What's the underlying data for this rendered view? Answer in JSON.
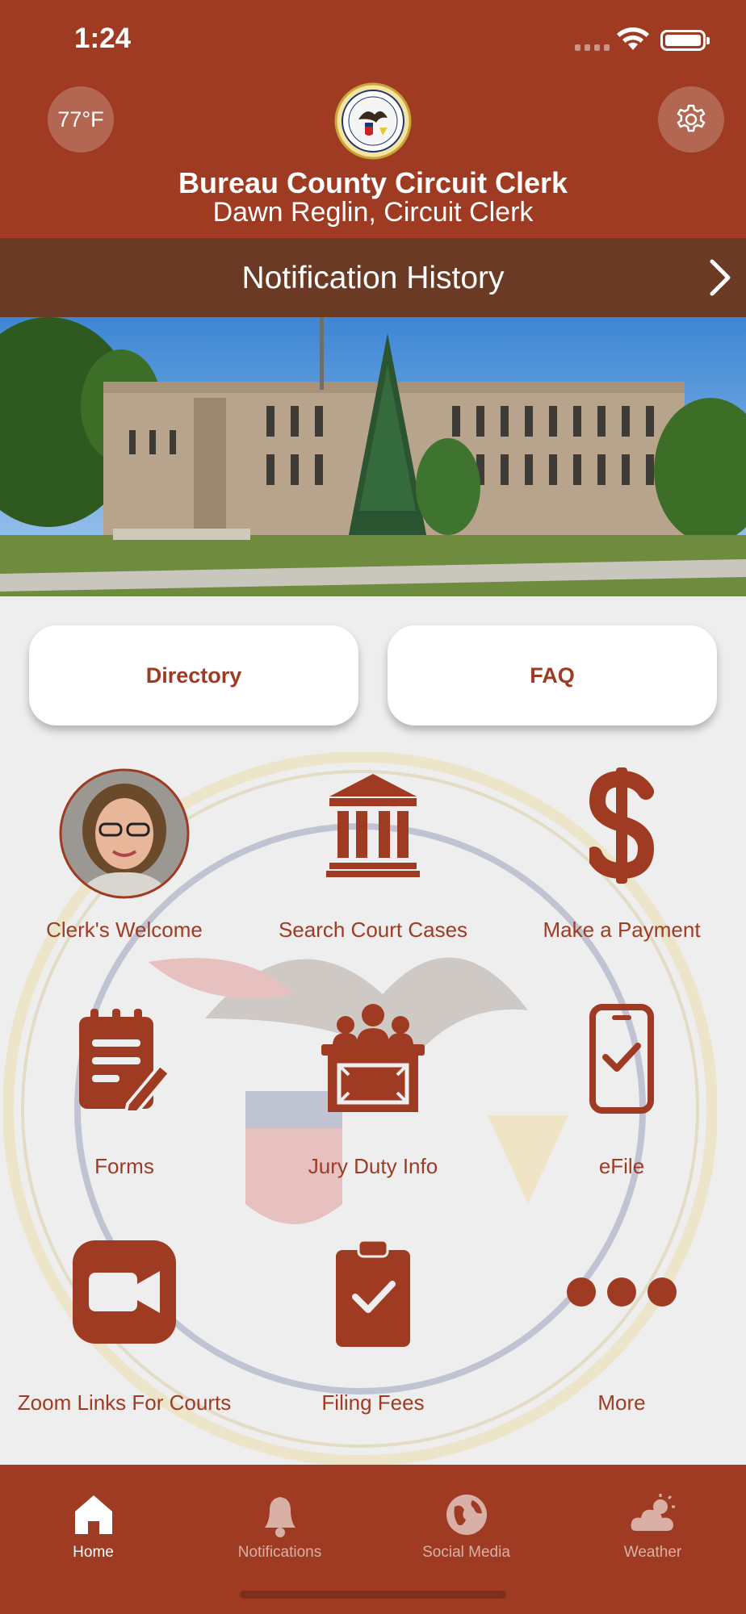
{
  "status": {
    "time": "1:24"
  },
  "header": {
    "temperature": "77°F",
    "title": "Bureau County Circuit Clerk",
    "subtitle": "Dawn Reglin, Circuit Clerk"
  },
  "notification_bar": {
    "label": "Notification History"
  },
  "quick_buttons": {
    "directory": "Directory",
    "faq": "FAQ"
  },
  "tiles": [
    {
      "label": "Clerk's Welcome",
      "icon": "portrait-photo"
    },
    {
      "label": "Search Court Cases",
      "icon": "courthouse-icon"
    },
    {
      "label": "Make a Payment",
      "icon": "dollar-icon"
    },
    {
      "label": "Forms",
      "icon": "form-edit-icon"
    },
    {
      "label": "Jury Duty Info",
      "icon": "jury-box-icon"
    },
    {
      "label": "eFile",
      "icon": "phone-check-icon"
    },
    {
      "label": "Zoom Links For Courts",
      "icon": "video-camera-icon"
    },
    {
      "label": "Filing Fees",
      "icon": "clipboard-check-icon"
    },
    {
      "label": "More",
      "icon": "ellipsis-icon"
    }
  ],
  "tabs": [
    {
      "label": "Home",
      "icon": "home-icon",
      "active": true
    },
    {
      "label": "Notifications",
      "icon": "bell-icon",
      "active": false
    },
    {
      "label": "Social Media",
      "icon": "globe-icon",
      "active": false
    },
    {
      "label": "Weather",
      "icon": "weather-icon",
      "active": false
    }
  ],
  "colors": {
    "brand": "#9e3b22",
    "notification_bar": "#6a3a24",
    "background": "#efeeee"
  }
}
